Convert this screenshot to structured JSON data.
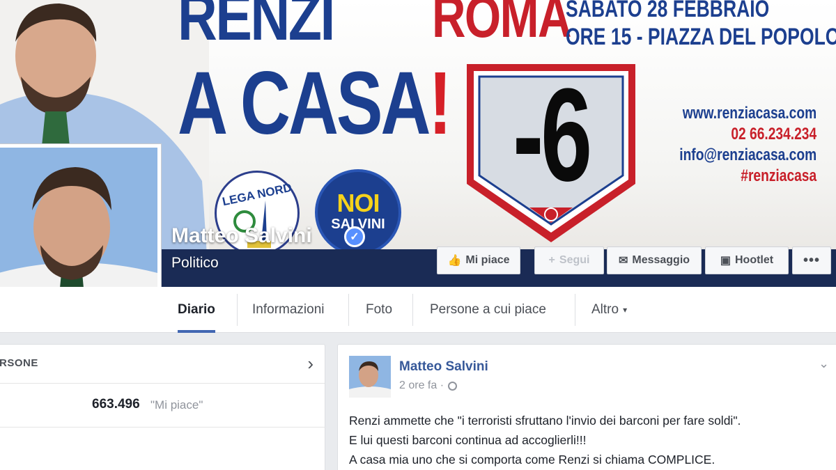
{
  "cover": {
    "headline_line1": "RENZI",
    "headline_line2": "A CASA",
    "headline_exclam": "!",
    "city": "ROMA",
    "event_date": "SABATO 28 FEBBRAIO",
    "event_place": "ORE 15 - PIAZZA DEL POPOLO",
    "countdown": "-6",
    "contacts": {
      "web": "www.renziacasa.com",
      "phone": "02 66.234.234",
      "email": "info@renziacasa.com",
      "hashtag": "#renziacasa"
    },
    "logo_lega": "LEGA NORD",
    "logo_noi_top": "NOI",
    "logo_noi_bottom": "SALVINI"
  },
  "page": {
    "name": "Matteo Salvini",
    "category": "Politico"
  },
  "actions": {
    "like": "Mi piace",
    "follow": "Segui",
    "message": "Messaggio",
    "hootlet": "Hootlet",
    "more": "•••"
  },
  "tabs": {
    "diario": "Diario",
    "info": "Informazioni",
    "foto": "Foto",
    "likes": "Persone a cui piace",
    "altro": "Altro"
  },
  "left_card": {
    "title": "RSONE",
    "likes_count": "663.496",
    "likes_label": "\"Mi piace\""
  },
  "post": {
    "author": "Matteo Salvini",
    "time": "2 ore fa ·",
    "lines": [
      "Renzi ammette che \"i terroristi sfruttano l'invio dei barconi per fare soldi\".",
      "E lui questi barconi continua ad accoglierli!!!",
      "A casa mia uno che si comporta come Renzi si chiama COMPLICE."
    ]
  },
  "colors": {
    "brand_blue": "#1c3f8f",
    "brand_red": "#c8202a",
    "fb_blue": "#4267b2",
    "link_blue": "#365899"
  }
}
